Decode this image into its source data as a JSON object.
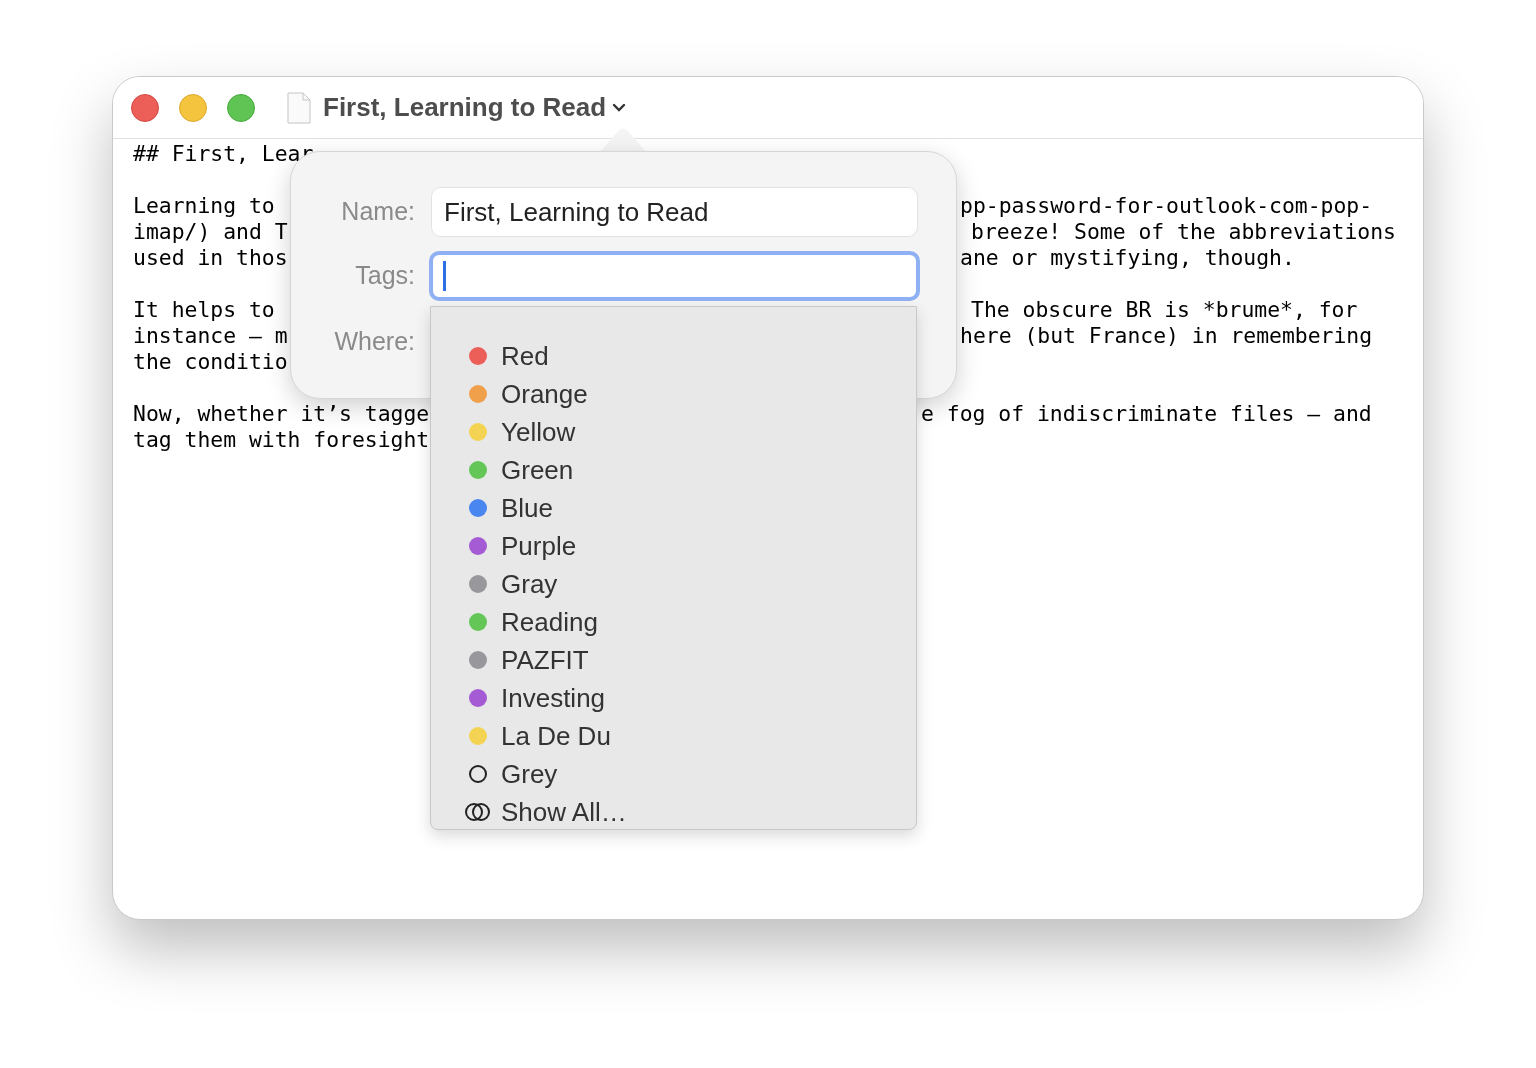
{
  "window": {
    "title": "First, Learning to Read"
  },
  "editor": {
    "paragraphs": [
      [
        {
          "left": "## First, Lear"
        }
      ],
      [
        {
          "left": "Learning to",
          "right": "pp-password-for-outlook-com-pop-"
        },
        {
          "left": "imap/) and T",
          "right": "breeze! Some of the abbreviations"
        },
        {
          "left": "used in thos",
          "right": "ane or mystifying, though."
        }
      ],
      [
        {
          "left": "It helps to",
          "right": "The obscure BR is *brume*, for"
        },
        {
          "left": "instance — m",
          "right": "here (but France) in remembering"
        },
        {
          "left": "the conditio"
        }
      ],
      [
        {
          "left": "Now, whether it’s tagge",
          "right": "e fog of indiscriminate files — and"
        },
        {
          "left": "tag them with foresight"
        }
      ]
    ]
  },
  "popover": {
    "fields": [
      {
        "label": "Name:",
        "value": "First, Learning to Read",
        "focused": false
      },
      {
        "label": "Tags:",
        "focused": true
      }
    ],
    "where_label": "Where:"
  },
  "tag_menu": {
    "items": [
      {
        "kind": "tag",
        "label": "Red",
        "color": "#ec5f58"
      },
      {
        "kind": "tag",
        "label": "Orange",
        "color": "#f0a04b"
      },
      {
        "kind": "tag",
        "label": "Yellow",
        "color": "#f5d352"
      },
      {
        "kind": "tag",
        "label": "Green",
        "color": "#63c656"
      },
      {
        "kind": "tag",
        "label": "Blue",
        "color": "#4a86f0"
      },
      {
        "kind": "tag",
        "label": "Purple",
        "color": "#a45bd3"
      },
      {
        "kind": "tag",
        "label": "Gray",
        "color": "#98989c"
      },
      {
        "kind": "tag",
        "label": "Reading",
        "color": "#63c656"
      },
      {
        "kind": "tag",
        "label": "PAZFIT",
        "color": "#98989c"
      },
      {
        "kind": "tag",
        "label": "Investing",
        "color": "#a45bd3"
      },
      {
        "kind": "tag",
        "label": "La De Du",
        "color": "#f5d352"
      },
      {
        "kind": "empty_tag",
        "label": "Grey"
      },
      {
        "kind": "show_all",
        "label": "Show All…"
      }
    ]
  }
}
